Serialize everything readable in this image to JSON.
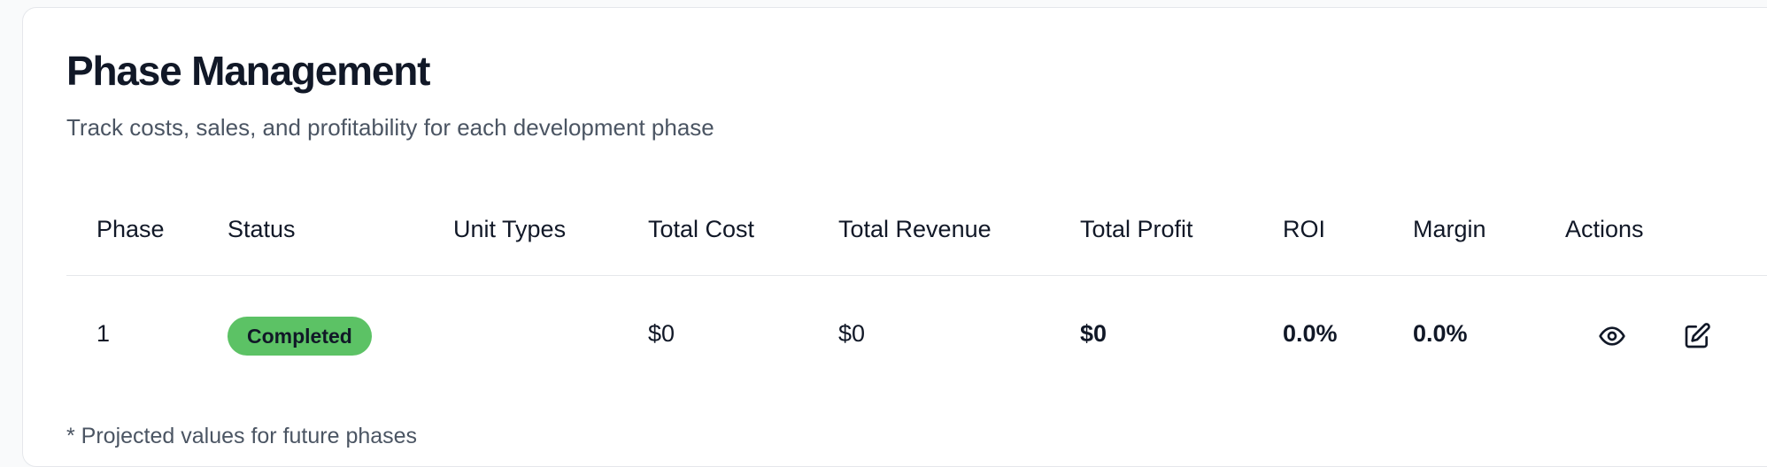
{
  "header": {
    "title": "Phase Management",
    "subtitle": "Track costs, sales, and profitability for each development phase"
  },
  "table": {
    "columns": [
      "Phase",
      "Status",
      "Unit Types",
      "Total Cost",
      "Total Revenue",
      "Total Profit",
      "ROI",
      "Margin",
      "Actions"
    ],
    "rows": [
      {
        "phase": "1",
        "status": "Completed",
        "unit_types": "",
        "total_cost": "$0",
        "total_revenue": "$0",
        "total_profit": "$0",
        "roi": "0.0%",
        "margin": "0.0%",
        "actions": [
          "eye-icon",
          "edit-icon"
        ]
      }
    ]
  },
  "footnote": "* Projected values for future phases",
  "colors": {
    "status_completed": "#5cc265",
    "text_primary": "#111827",
    "text_secondary": "#4b5563",
    "border": "#e5e7eb"
  }
}
